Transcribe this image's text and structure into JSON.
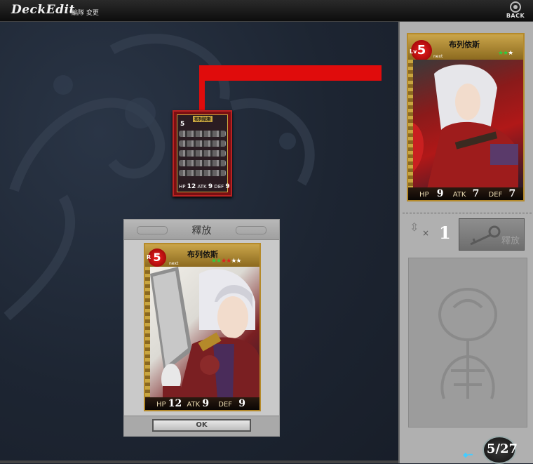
{
  "header": {
    "title": "DeckEdit",
    "subtitle": "編隊 変更",
    "back_label": "BACK"
  },
  "mini_card": {
    "name": "布列依斯",
    "level": "5",
    "hp": "12",
    "atk": "9",
    "def": "9"
  },
  "dialog": {
    "title": "釋放",
    "ok_label": "OK",
    "card": {
      "rarity": "R",
      "level": "5",
      "name": "布列依斯",
      "next_label": "next",
      "hp_label": "HP",
      "hp": "12",
      "atk_label": "ATK",
      "atk": "9",
      "def_label": "DEF",
      "def": "9",
      "stars": [
        "green",
        "green",
        "red",
        "red",
        "white",
        "white"
      ]
    }
  },
  "panel": {
    "card": {
      "lv_label": "Lv",
      "level": "5",
      "name": "布列依斯",
      "next_label": "next",
      "hp_label": "HP",
      "hp": "9",
      "atk_label": "ATK",
      "atk": "7",
      "def_label": "DEF",
      "def": "7",
      "stars": [
        "green",
        "green",
        "white"
      ]
    },
    "count_x": "×",
    "release_count": "1",
    "release_label": "釋放",
    "deck_counter": "5/27"
  },
  "colors": {
    "arrow": "#e00c0c",
    "background": "#1b2330",
    "panel": "#b0b0b0"
  }
}
